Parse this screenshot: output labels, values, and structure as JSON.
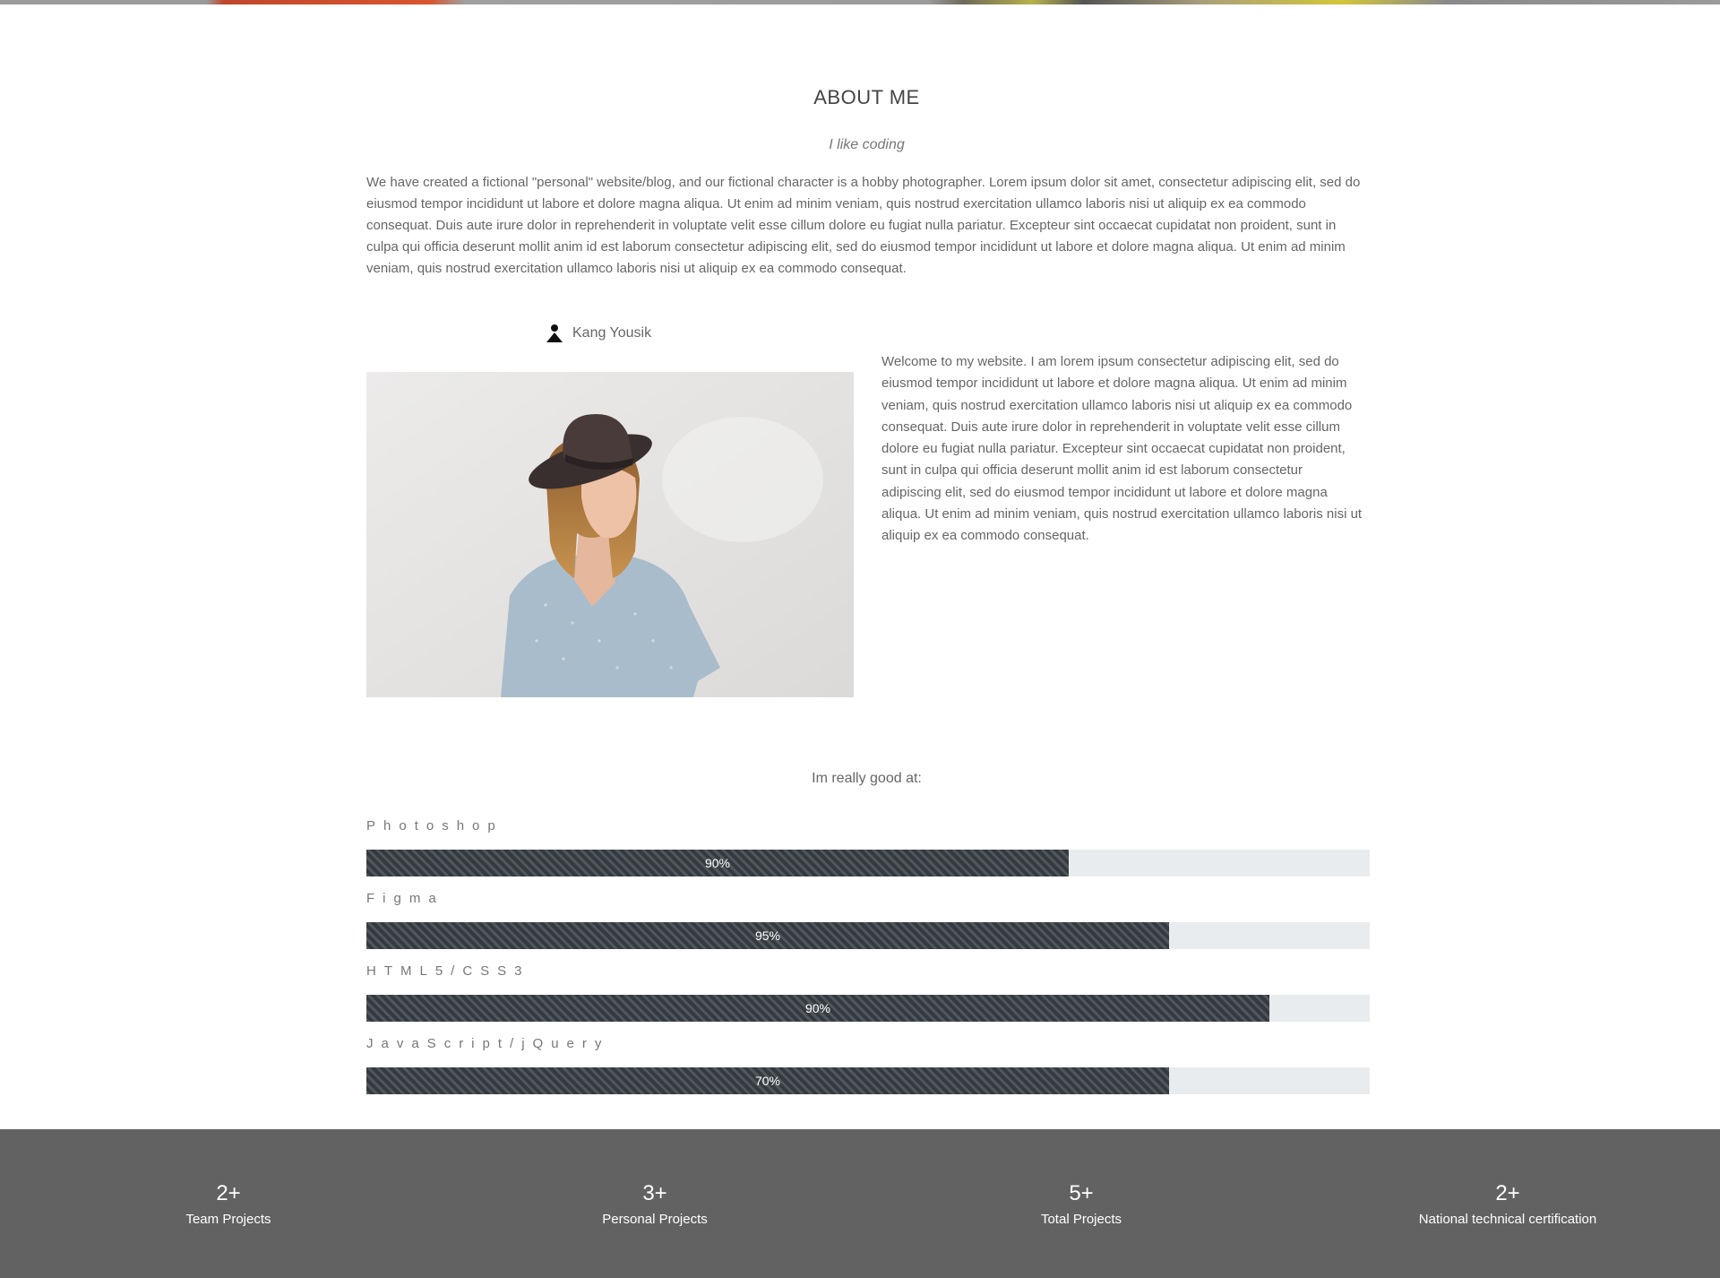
{
  "about": {
    "title": "ABOUT ME",
    "tagline": "I like coding",
    "intro": "We have created a fictional \"personal\" website/blog, and our fictional character is a hobby photographer. Lorem ipsum dolor sit amet, consectetur adipiscing elit, sed do eiusmod tempor incididunt ut labore et dolore magna aliqua. Ut enim ad minim veniam, quis nostrud exercitation ullamco laboris nisi ut aliquip ex ea commodo consequat. Duis aute irure dolor in reprehenderit in voluptate velit esse cillum dolore eu fugiat nulla pariatur. Excepteur sint occaecat cupidatat non proident, sunt in culpa qui officia deserunt mollit anim id est laborum consectetur adipiscing elit, sed do eiusmod tempor incididunt ut labore et dolore magna aliqua. Ut enim ad minim veniam, quis nostrud exercitation ullamco laboris nisi ut aliquip ex ea commodo consequat.",
    "author_name": "Kang Yousik",
    "author_icon": "person-icon",
    "welcome": "Welcome to my website. I am lorem ipsum consectetur adipiscing elit, sed do eiusmod tempor incididunt ut labore et dolore magna aliqua. Ut enim ad minim veniam, quis nostrud exercitation ullamco laboris nisi ut aliquip ex ea commodo consequat. Duis aute irure dolor in reprehenderit in voluptate velit esse cillum dolore eu fugiat nulla pariatur. Excepteur sint occaecat cupidatat non proident, sunt in culpa qui officia deserunt mollit anim id est laborum consectetur adipiscing elit, sed do eiusmod tempor incididunt ut labore et dolore magna aliqua. Ut enim ad minim veniam, quis nostrud exercitation ullamco laboris nisi ut aliquip ex ea commodo consequat."
  },
  "skills": {
    "heading": "Im really good at:",
    "items": [
      {
        "name": "Photoshop",
        "label": "90%",
        "fill_fraction": 0.7
      },
      {
        "name": "Figma",
        "label": "95%",
        "fill_fraction": 0.8
      },
      {
        "name": "HTML5/CSS3",
        "label": "90%",
        "fill_fraction": 0.9
      },
      {
        "name": "JavaScript/jQuery",
        "label": "70%",
        "fill_fraction": 0.8
      }
    ]
  },
  "stats": [
    {
      "value": "2+",
      "label": "Team Projects"
    },
    {
      "value": "3+",
      "label": "Personal Projects"
    },
    {
      "value": "5+",
      "label": "Total Projects"
    },
    {
      "value": "2+",
      "label": "National technical certification"
    }
  ],
  "colors": {
    "bar_fill": "#343a40",
    "bar_track": "#e9ecef",
    "stats_band": "#626262"
  }
}
